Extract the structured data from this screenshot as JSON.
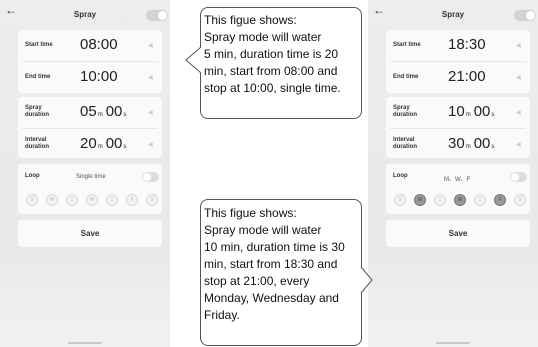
{
  "left_phone": {
    "header": {
      "back_icon": "←",
      "title": "Spray"
    },
    "time": {
      "start_label": "Start time",
      "start_value": "08:00",
      "end_label": "End time",
      "end_value": "10:00"
    },
    "duration": {
      "spray_label": "Spray duration",
      "spray_minutes": "05",
      "spray_seconds": "00",
      "interval_label": "Interval duration",
      "interval_minutes": "20",
      "interval_seconds": "00",
      "minute_unit": "m",
      "second_unit": "s"
    },
    "loop": {
      "label": "Loop",
      "value": "Single time",
      "toggle_on": false
    },
    "days": [
      {
        "label": "S",
        "selected": false
      },
      {
        "label": "M",
        "selected": false
      },
      {
        "label": "T",
        "selected": false
      },
      {
        "label": "W",
        "selected": false
      },
      {
        "label": "T",
        "selected": false
      },
      {
        "label": "F",
        "selected": false
      },
      {
        "label": "S",
        "selected": false
      }
    ],
    "save_label": "Save"
  },
  "right_phone": {
    "header": {
      "back_icon": "←",
      "title": "Spray"
    },
    "time": {
      "start_label": "Start time",
      "start_value": "18:30",
      "end_label": "End time",
      "end_value": "21:00"
    },
    "duration": {
      "spray_label": "Spray duration",
      "spray_minutes": "10",
      "spray_seconds": "00",
      "interval_label": "Interval duration",
      "interval_minutes": "30",
      "interval_seconds": "00",
      "minute_unit": "m",
      "second_unit": "s"
    },
    "loop": {
      "label": "Loop",
      "value": "M、W、F",
      "toggle_on": false
    },
    "days": [
      {
        "label": "S",
        "selected": false
      },
      {
        "label": "M",
        "selected": true
      },
      {
        "label": "T",
        "selected": false
      },
      {
        "label": "W",
        "selected": true
      },
      {
        "label": "T",
        "selected": false
      },
      {
        "label": "F",
        "selected": true
      },
      {
        "label": "S",
        "selected": false
      }
    ],
    "save_label": "Save"
  },
  "callout_top": {
    "text": "This figue shows:\nSpray mode will water\n5 min, duration time is 20\nmin, start from 08:00 and\nstop at 10:00, single time."
  },
  "callout_bottom": {
    "text": "This figue shows:\nSpray mode will water\n10 min, duration time is 30\nmin, start from 18:30 and\nstop at 21:00, every\nMonday, Wednesday and\nFriday."
  },
  "colors": {
    "selected_day": "#9a9a9a",
    "card": "#fafafa",
    "background": "#ededed"
  }
}
